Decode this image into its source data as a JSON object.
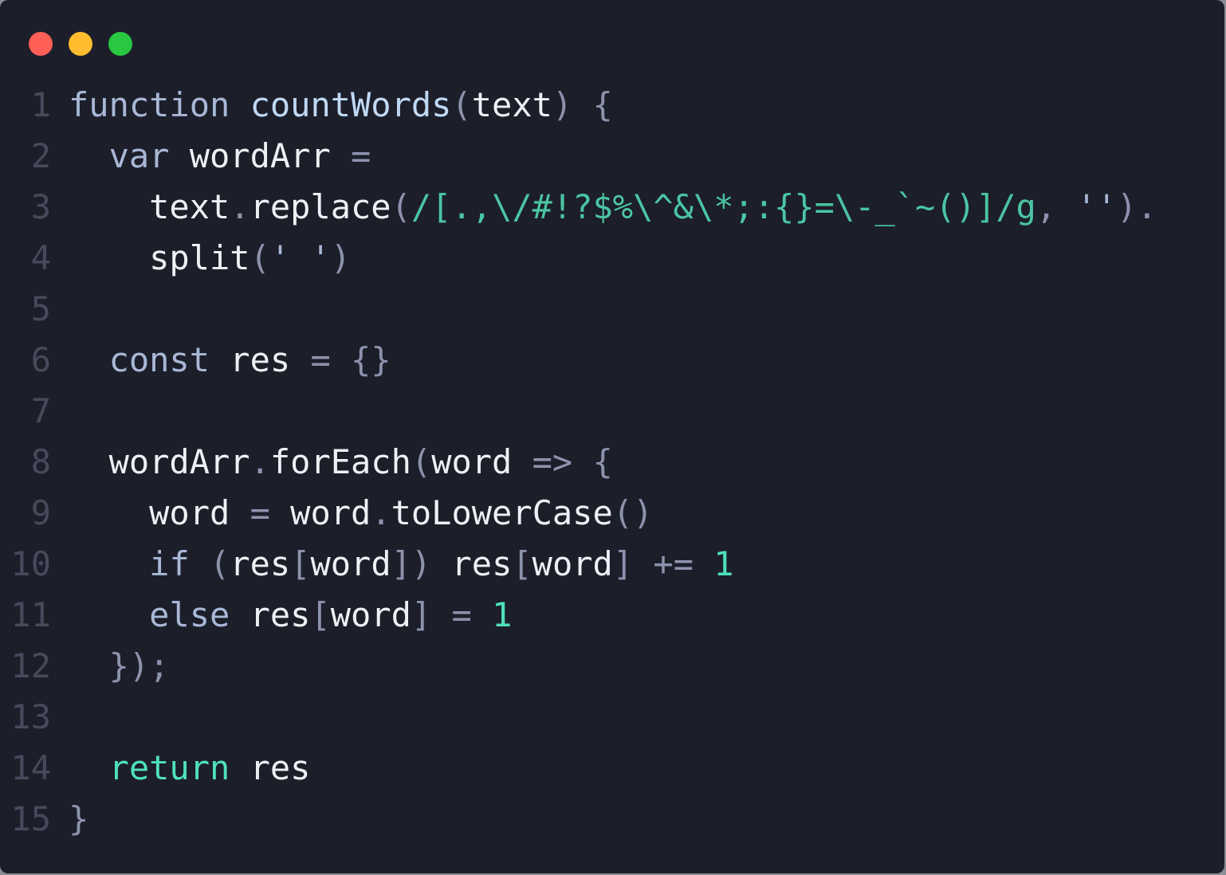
{
  "window": {
    "controls": [
      {
        "name": "close",
        "color": "#fe5f57"
      },
      {
        "name": "minimize",
        "color": "#febc2e"
      },
      {
        "name": "maximize",
        "color": "#28c840"
      }
    ]
  },
  "lines": [
    {
      "n": "1",
      "tokens": [
        [
          "kw",
          "function"
        ],
        [
          "id",
          " "
        ],
        [
          "fn",
          "countWords"
        ],
        [
          "pn",
          "("
        ],
        [
          "id",
          "text"
        ],
        [
          "pn",
          ")"
        ],
        [
          "id",
          " "
        ],
        [
          "pn",
          "{"
        ]
      ]
    },
    {
      "n": "2",
      "tokens": [
        [
          "id",
          "  "
        ],
        [
          "kw",
          "var"
        ],
        [
          "id",
          " wordArr "
        ],
        [
          "pn",
          "="
        ]
      ]
    },
    {
      "n": "3",
      "tokens": [
        [
          "id",
          "    text"
        ],
        [
          "pn",
          "."
        ],
        [
          "id",
          "replace"
        ],
        [
          "pn",
          "("
        ],
        [
          "rx",
          "/[.,\\/#!?$%\\^&\\*;:{}=\\-_`~()]/g"
        ],
        [
          "pn",
          ","
        ],
        [
          "id",
          " "
        ],
        [
          "str",
          "''"
        ],
        [
          "pn",
          ")."
        ]
      ]
    },
    {
      "n": "4",
      "tokens": [
        [
          "id",
          "    split"
        ],
        [
          "pn",
          "("
        ],
        [
          "str",
          "' '"
        ],
        [
          "pn",
          ")"
        ]
      ]
    },
    {
      "n": "5",
      "tokens": []
    },
    {
      "n": "6",
      "tokens": [
        [
          "id",
          "  "
        ],
        [
          "kw",
          "const"
        ],
        [
          "id",
          " res "
        ],
        [
          "pn",
          "="
        ],
        [
          "id",
          " "
        ],
        [
          "pn",
          "{}"
        ]
      ]
    },
    {
      "n": "7",
      "tokens": []
    },
    {
      "n": "8",
      "tokens": [
        [
          "id",
          "  wordArr"
        ],
        [
          "pn",
          "."
        ],
        [
          "id",
          "forEach"
        ],
        [
          "pn",
          "("
        ],
        [
          "id",
          "word "
        ],
        [
          "pn",
          "=>"
        ],
        [
          "id",
          " "
        ],
        [
          "pn",
          "{"
        ]
      ]
    },
    {
      "n": "9",
      "tokens": [
        [
          "id",
          "    word "
        ],
        [
          "pn",
          "="
        ],
        [
          "id",
          " word"
        ],
        [
          "pn",
          "."
        ],
        [
          "id",
          "toLowerCase"
        ],
        [
          "pn",
          "()"
        ]
      ]
    },
    {
      "n": "10",
      "tokens": [
        [
          "id",
          "    "
        ],
        [
          "kw",
          "if"
        ],
        [
          "id",
          " "
        ],
        [
          "pn",
          "("
        ],
        [
          "id",
          "res"
        ],
        [
          "pn",
          "["
        ],
        [
          "id",
          "word"
        ],
        [
          "pn",
          "])"
        ],
        [
          "id",
          " res"
        ],
        [
          "pn",
          "["
        ],
        [
          "id",
          "word"
        ],
        [
          "pn",
          "]"
        ],
        [
          "id",
          " "
        ],
        [
          "pn",
          "+="
        ],
        [
          "id",
          " "
        ],
        [
          "num",
          "1"
        ]
      ]
    },
    {
      "n": "11",
      "tokens": [
        [
          "id",
          "    "
        ],
        [
          "kw",
          "else"
        ],
        [
          "id",
          " res"
        ],
        [
          "pn",
          "["
        ],
        [
          "id",
          "word"
        ],
        [
          "pn",
          "]"
        ],
        [
          "id",
          " "
        ],
        [
          "pn",
          "="
        ],
        [
          "id",
          " "
        ],
        [
          "num",
          "1"
        ]
      ]
    },
    {
      "n": "12",
      "tokens": [
        [
          "id",
          "  "
        ],
        [
          "pn",
          "});"
        ]
      ]
    },
    {
      "n": "13",
      "tokens": []
    },
    {
      "n": "14",
      "tokens": [
        [
          "id",
          "  "
        ],
        [
          "ret",
          "return"
        ],
        [
          "id",
          " res"
        ]
      ]
    },
    {
      "n": "15",
      "tokens": [
        [
          "pn",
          "}"
        ]
      ]
    }
  ]
}
